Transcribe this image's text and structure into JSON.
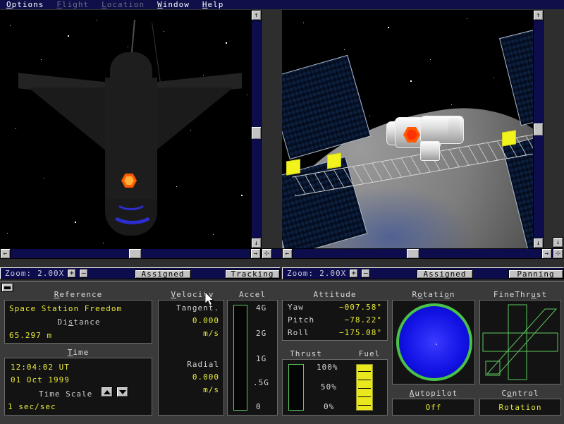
{
  "menu": {
    "items": [
      {
        "label": "Options",
        "enabled": true
      },
      {
        "label": "Flight",
        "enabled": false
      },
      {
        "label": "Location",
        "enabled": false
      },
      {
        "label": "Window",
        "enabled": true
      },
      {
        "label": "Help",
        "enabled": true
      }
    ]
  },
  "viewport_left": {
    "zoom_label": "Zoom:",
    "zoom_value": "2.00X",
    "zoom_in": "+",
    "zoom_out": "–",
    "mode_button": "Assigned",
    "action_button": "Tracking",
    "scroll_up": "↑",
    "scroll_down": "↓",
    "scroll_left": "←",
    "scroll_right": "→",
    "center_button": "⊹"
  },
  "viewport_right": {
    "zoom_label": "Zoom:",
    "zoom_value": "2.00X",
    "zoom_in": "+",
    "zoom_out": "–",
    "mode_button": "Assigned",
    "action_button": "Panning",
    "scroll_up": "↑",
    "scroll_down": "↓",
    "scroll_left": "←",
    "scroll_right": "→",
    "center_button": "⊹"
  },
  "panel": {
    "minimize_button": "–",
    "reference": {
      "title": "Reference",
      "target": "Space Station Freedom",
      "distance_label": "Distance",
      "distance_value": "65.297 m"
    },
    "time": {
      "title": "Time",
      "clock": "12:04:02 UT",
      "date": "01 Oct 1999",
      "scale_label": "Time Scale",
      "scale_up": "▲",
      "scale_down": "▼",
      "scale_value": "1 sec/sec"
    },
    "velocity": {
      "title": "Velocity",
      "tangent_label": "Tangent.",
      "tangent_value": "0.000",
      "tangent_unit": "m/s",
      "radial_label": "Radial",
      "radial_value": "0.000",
      "radial_unit": "m/s"
    },
    "accel": {
      "title": "Accel",
      "value_percent": 0,
      "ticks": [
        "4G",
        "2G",
        "1G",
        ".5G",
        "0"
      ]
    },
    "attitude": {
      "title": "Attitude",
      "yaw_label": "Yaw",
      "yaw_value": "−007.58°",
      "pitch_label": "Pitch",
      "pitch_value": "−78.22°",
      "roll_label": "Roll",
      "roll_value": "−175.08°"
    },
    "thrust": {
      "title": "Thrust",
      "value_percent": 0,
      "ticks": [
        "100%",
        "50%",
        "0%"
      ]
    },
    "fuel": {
      "title": "Fuel",
      "value_percent": 100
    },
    "rotation": {
      "title": "Rotation"
    },
    "finethrust": {
      "title": "FineThrust"
    },
    "autopilot": {
      "title": "Autopilot",
      "value": "Off"
    },
    "control": {
      "title": "Control",
      "value": "Rotation"
    }
  },
  "colors": {
    "menu_bg": "#0f0f4a",
    "value_yellow": "#e8e83c",
    "gauge_green": "#5ec85e",
    "fuel_yellow": "#e8e81c",
    "rotation_blue": "#1414e6",
    "marker_orange": "#ff5a00",
    "panel_bg": "#3a3a3a"
  }
}
